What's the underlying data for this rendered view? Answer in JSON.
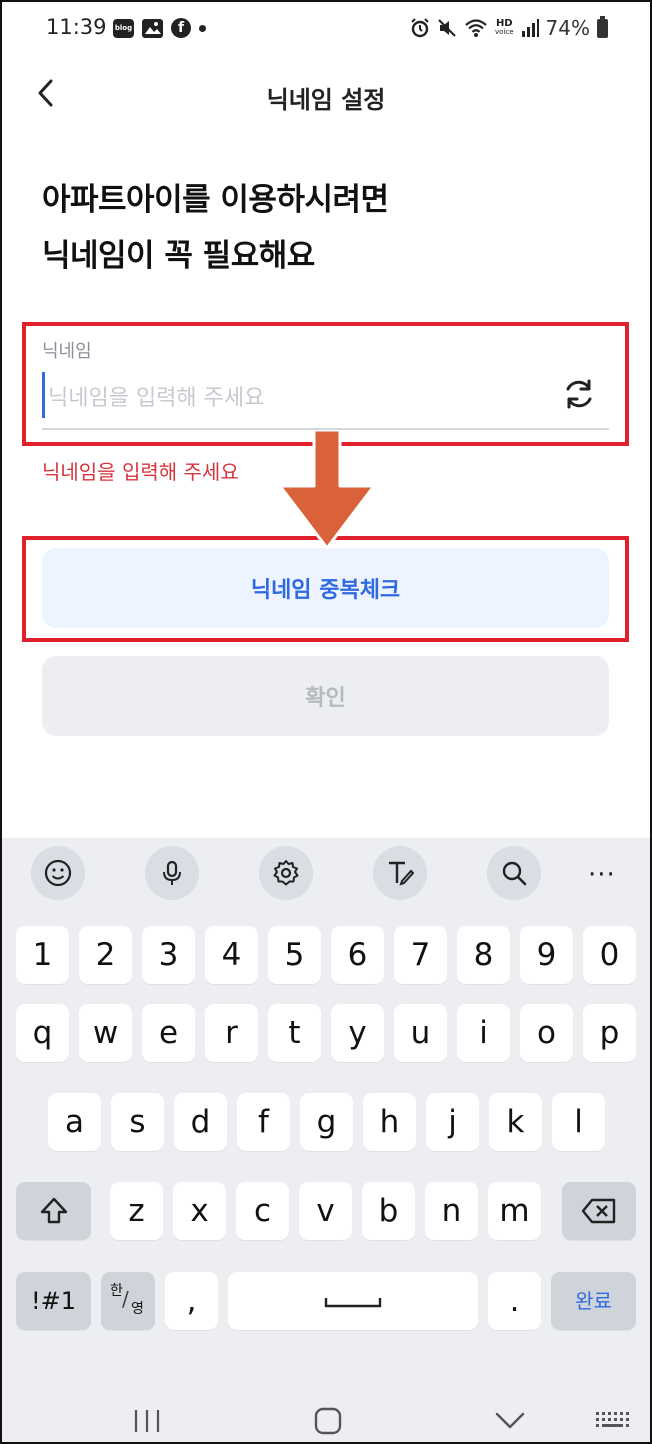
{
  "status_bar": {
    "time": "11:39",
    "left_icons": [
      "blog-icon",
      "gallery-icon",
      "facebook-icon",
      "dot-icon"
    ],
    "blog_label": "blog",
    "battery": "74%",
    "right_icons": [
      "alarm-icon",
      "mute-icon",
      "wifi-icon",
      "hd-voice-icon",
      "signal-icon",
      "battery-icon"
    ],
    "hd_top": "HD",
    "hd_bottom": "voice"
  },
  "header": {
    "title": "닉네임 설정",
    "back_icon": "chevron-left-icon"
  },
  "main": {
    "heading_line1": "아파트아이를 이용하시려면",
    "heading_line2": "닉네임이 꼭 필요해요",
    "field_label": "닉네임",
    "input_value": "",
    "input_placeholder": "닉네임을 입력해 주세요",
    "refresh_icon": "refresh-icon",
    "error_text": "닉네임을 입력해 주세요",
    "dup_check_label": "닉네임 중복체크",
    "confirm_label": "확인"
  },
  "annotation": {
    "color": "#e0202b",
    "arrow_color": "#d9623a"
  },
  "colors": {
    "accent": "#2f6ae0",
    "error": "#d8343d",
    "dup_button_bg": "#eef4ff",
    "disabled_button_bg": "#eceef1"
  },
  "keyboard": {
    "toolbar": [
      "emoji-icon",
      "mic-icon",
      "settings-icon",
      "handwriting-icon",
      "search-icon",
      "more-icon"
    ],
    "more_label": "···",
    "number_row": [
      "1",
      "2",
      "3",
      "4",
      "5",
      "6",
      "7",
      "8",
      "9",
      "0"
    ],
    "row1": [
      "q",
      "w",
      "e",
      "r",
      "t",
      "y",
      "u",
      "i",
      "o",
      "p"
    ],
    "row2": [
      "a",
      "s",
      "d",
      "f",
      "g",
      "h",
      "j",
      "k",
      "l"
    ],
    "row3": [
      "z",
      "x",
      "c",
      "v",
      "b",
      "n",
      "m"
    ],
    "symbols_label": "!#1",
    "lang_top": "한",
    "lang_bottom": "영",
    "comma_label": ",",
    "period_label": ".",
    "done_label": "완료",
    "shift_icon": "shift-icon",
    "backspace_icon": "backspace-icon",
    "space_icon": "space-icon"
  },
  "navbar": [
    "recent-apps-icon",
    "home-icon",
    "back-icon",
    "keyboard-toggle-icon"
  ]
}
